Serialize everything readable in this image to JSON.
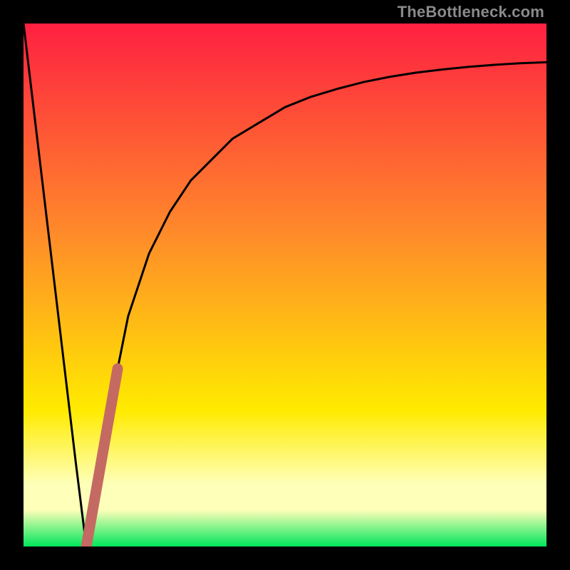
{
  "watermark": {
    "text": "TheBottleneck.com"
  },
  "colors": {
    "black": "#000000",
    "curve": "#000000",
    "overlay_stroke": "#c46a63",
    "grad_top": "#fe2041",
    "grad_mid1": "#ff8a2a",
    "grad_mid2": "#ffeb00",
    "grad_pale": "#feffb8",
    "grad_bottom": "#00e65a"
  },
  "chart_data": {
    "type": "line",
    "title": "",
    "xlabel": "",
    "ylabel": "",
    "xlim": [
      0,
      100
    ],
    "ylim": [
      0,
      100
    ],
    "grid": false,
    "legend": false,
    "series": [
      {
        "name": "bottleneck-curve",
        "x": [
          0,
          5,
          10,
          12,
          14,
          16,
          18,
          20,
          24,
          28,
          32,
          36,
          40,
          45,
          50,
          55,
          60,
          65,
          70,
          75,
          80,
          85,
          90,
          95,
          100
        ],
        "y": [
          100,
          58,
          16,
          0,
          10,
          22,
          34,
          44,
          56,
          64,
          70,
          74,
          78,
          81,
          84,
          86,
          87.5,
          88.8,
          89.8,
          90.6,
          91.2,
          91.7,
          92.1,
          92.4,
          92.6
        ]
      }
    ],
    "overlay_segment": {
      "name": "highlighted-range",
      "x": [
        12,
        18
      ],
      "y": [
        0,
        34
      ]
    }
  }
}
